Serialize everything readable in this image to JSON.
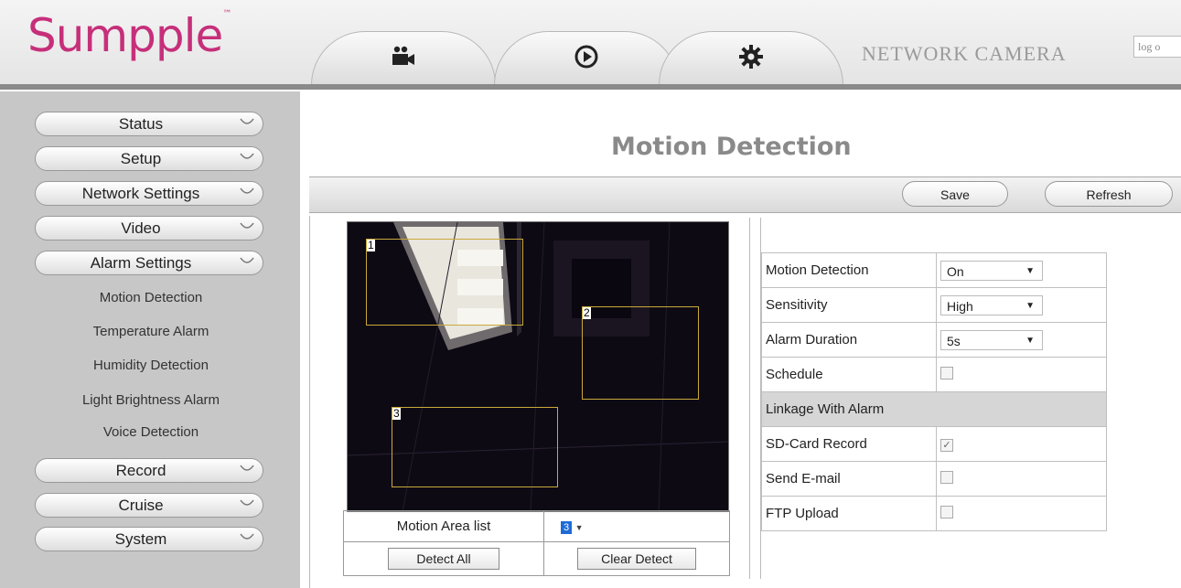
{
  "header": {
    "logo": "Sumpple",
    "logo_tm": "™",
    "brand": "NETWORK CAMERA",
    "logout": "log o",
    "tabs": [
      {
        "icon": "video-camera-icon"
      },
      {
        "icon": "play-icon"
      },
      {
        "icon": "gear-icon"
      }
    ]
  },
  "sidebar": {
    "menu": [
      {
        "label": "Status"
      },
      {
        "label": "Setup"
      },
      {
        "label": "Network Settings"
      },
      {
        "label": "Video"
      },
      {
        "label": "Alarm Settings"
      }
    ],
    "submenu": [
      {
        "label": "Motion Detection"
      },
      {
        "label": "Temperature Alarm"
      },
      {
        "label": "Humidity Detection"
      },
      {
        "label": "Light Brightness Alarm"
      },
      {
        "label": "Voice Detection"
      }
    ],
    "menu_bottom": [
      {
        "label": "Record"
      },
      {
        "label": "Cruise"
      },
      {
        "label": "System"
      }
    ]
  },
  "main": {
    "title": "Motion Detection",
    "save": "Save",
    "refresh": "Refresh",
    "video": {
      "areas": [
        {
          "label": "1"
        },
        {
          "label": "2"
        },
        {
          "label": "3"
        }
      ],
      "area_color": "#c9a93a"
    },
    "motion_area_list_label": "Motion Area list",
    "motion_area_value": "3",
    "detect_all": "Detect All",
    "clear_detect": "Clear Detect",
    "settings": {
      "motion_detection": {
        "label": "Motion Detection",
        "value": "On"
      },
      "sensitivity": {
        "label": "Sensitivity",
        "value": "High"
      },
      "alarm_duration": {
        "label": "Alarm Duration",
        "value": "5s"
      },
      "schedule": {
        "label": "Schedule",
        "checked": false
      },
      "linkage_header": "Linkage With Alarm",
      "sd_card_record": {
        "label": "SD-Card Record",
        "checked": true,
        "mark": "✓"
      },
      "send_email": {
        "label": "Send E-mail",
        "checked": false
      },
      "ftp_upload": {
        "label": "FTP Upload",
        "checked": false
      }
    }
  }
}
